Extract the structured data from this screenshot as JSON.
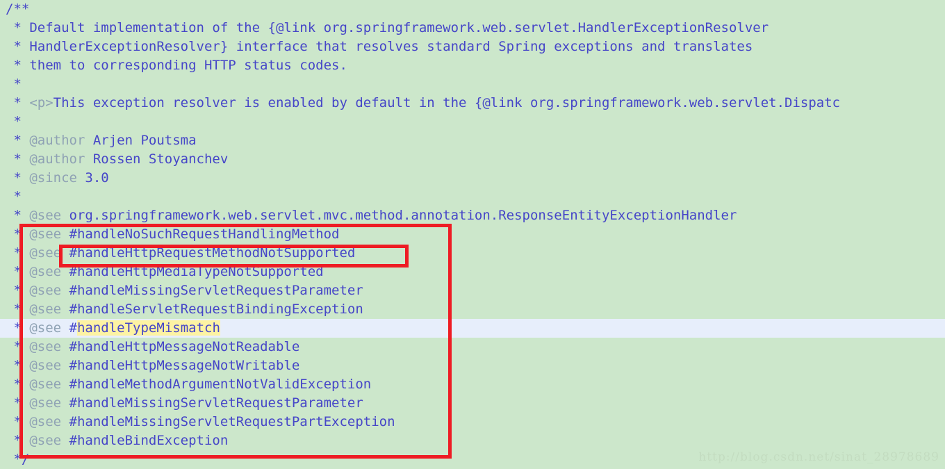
{
  "editor": {
    "background_color": "#cce7cb",
    "text_color": "#4646c8",
    "tag_color": "#8fa2b4",
    "current_line_color": "#e7eefb",
    "search_highlight_color": "#fdf3a3",
    "annotation_color": "#ee1c24",
    "font_size_px": 19,
    "line_height_px": 27,
    "language": "java",
    "content_kind": "javadoc-comment"
  },
  "watermark": {
    "text": "http://blog.csdn.net/sinat_28978689"
  },
  "annotations": [
    {
      "name": "outer-red-rectangle",
      "shape": "rectangle",
      "color": "#ee1c24",
      "covers": "the block of @see handler references from #handleNoSuchRequestHandlingMethod through #handleBindException"
    },
    {
      "name": "inner-red-rectangle",
      "shape": "rectangle",
      "color": "#ee1c24",
      "covers": "#handleHttpRequestMethodNotSupported"
    }
  ],
  "lines": [
    {
      "index": 0,
      "current": false,
      "segments": [
        {
          "kind": "delim",
          "text": "/**"
        }
      ]
    },
    {
      "index": 1,
      "current": false,
      "segments": [
        {
          "kind": "delim",
          "text": " * "
        },
        {
          "kind": "text",
          "text": "Default implementation of the "
        },
        {
          "kind": "link",
          "text": "{@link org.springframework.web.servlet.HandlerExceptionResolver"
        }
      ]
    },
    {
      "index": 2,
      "current": false,
      "segments": [
        {
          "kind": "delim",
          "text": " * "
        },
        {
          "kind": "link",
          "text": "HandlerExceptionResolver}"
        },
        {
          "kind": "text",
          "text": " interface that resolves standard Spring exceptions and translates"
        }
      ]
    },
    {
      "index": 3,
      "current": false,
      "segments": [
        {
          "kind": "delim",
          "text": " * "
        },
        {
          "kind": "text",
          "text": "them to corresponding HTTP status codes."
        }
      ]
    },
    {
      "index": 4,
      "current": false,
      "segments": [
        {
          "kind": "delim",
          "text": " *"
        }
      ]
    },
    {
      "index": 5,
      "current": false,
      "segments": [
        {
          "kind": "delim",
          "text": " * "
        },
        {
          "kind": "html",
          "text": "<p>"
        },
        {
          "kind": "text",
          "text": "This exception resolver is enabled by default in the "
        },
        {
          "kind": "link",
          "text": "{@link org.springframework.web.servlet.Dispatc"
        }
      ]
    },
    {
      "index": 6,
      "current": false,
      "segments": [
        {
          "kind": "delim",
          "text": " *"
        }
      ]
    },
    {
      "index": 7,
      "current": false,
      "segments": [
        {
          "kind": "delim",
          "text": " * "
        },
        {
          "kind": "tag",
          "text": "@author"
        },
        {
          "kind": "text",
          "text": " Arjen Poutsma"
        }
      ]
    },
    {
      "index": 8,
      "current": false,
      "segments": [
        {
          "kind": "delim",
          "text": " * "
        },
        {
          "kind": "tag",
          "text": "@author"
        },
        {
          "kind": "text",
          "text": " Rossen Stoyanchev"
        }
      ]
    },
    {
      "index": 9,
      "current": false,
      "segments": [
        {
          "kind": "delim",
          "text": " * "
        },
        {
          "kind": "tag",
          "text": "@since"
        },
        {
          "kind": "text",
          "text": " 3.0"
        }
      ]
    },
    {
      "index": 10,
      "current": false,
      "segments": [
        {
          "kind": "delim",
          "text": " *"
        }
      ]
    },
    {
      "index": 11,
      "current": false,
      "segments": [
        {
          "kind": "delim",
          "text": " * "
        },
        {
          "kind": "tag",
          "text": "@see"
        },
        {
          "kind": "link",
          "text": " org.springframework.web.servlet.mvc.method.annotation.ResponseEntityExceptionHandler"
        }
      ]
    },
    {
      "index": 12,
      "current": false,
      "segments": [
        {
          "kind": "delim",
          "text": " * "
        },
        {
          "kind": "tag",
          "text": "@see"
        },
        {
          "kind": "link",
          "text": " #handleNoSuchRequestHandlingMethod"
        }
      ]
    },
    {
      "index": 13,
      "current": false,
      "segments": [
        {
          "kind": "delim",
          "text": " * "
        },
        {
          "kind": "tag",
          "text": "@see"
        },
        {
          "kind": "link",
          "text": " #handleHttpRequestMethodNotSupported"
        }
      ]
    },
    {
      "index": 14,
      "current": false,
      "segments": [
        {
          "kind": "delim",
          "text": " * "
        },
        {
          "kind": "tag",
          "text": "@see"
        },
        {
          "kind": "link",
          "text": " #handleHttpMediaTypeNotSupported"
        }
      ]
    },
    {
      "index": 15,
      "current": false,
      "segments": [
        {
          "kind": "delim",
          "text": " * "
        },
        {
          "kind": "tag",
          "text": "@see"
        },
        {
          "kind": "link",
          "text": " #handleMissingServletRequestParameter"
        }
      ]
    },
    {
      "index": 16,
      "current": false,
      "segments": [
        {
          "kind": "delim",
          "text": " * "
        },
        {
          "kind": "tag",
          "text": "@see"
        },
        {
          "kind": "link",
          "text": " #handleServletRequestBindingException"
        }
      ]
    },
    {
      "index": 17,
      "current": true,
      "segments": [
        {
          "kind": "delim",
          "text": " * "
        },
        {
          "kind": "tag",
          "text": "@see"
        },
        {
          "kind": "link",
          "text": " #"
        },
        {
          "kind": "highlight",
          "text": "handleTypeMismatch"
        }
      ]
    },
    {
      "index": 18,
      "current": false,
      "segments": [
        {
          "kind": "delim",
          "text": " * "
        },
        {
          "kind": "tag",
          "text": "@see"
        },
        {
          "kind": "link",
          "text": " #handleHttpMessageNotReadable"
        }
      ]
    },
    {
      "index": 19,
      "current": false,
      "segments": [
        {
          "kind": "delim",
          "text": " * "
        },
        {
          "kind": "tag",
          "text": "@see"
        },
        {
          "kind": "link",
          "text": " #handleHttpMessageNotWritable"
        }
      ]
    },
    {
      "index": 20,
      "current": false,
      "segments": [
        {
          "kind": "delim",
          "text": " * "
        },
        {
          "kind": "tag",
          "text": "@see"
        },
        {
          "kind": "link",
          "text": " #handleMethodArgumentNotValidException"
        }
      ]
    },
    {
      "index": 21,
      "current": false,
      "segments": [
        {
          "kind": "delim",
          "text": " * "
        },
        {
          "kind": "tag",
          "text": "@see"
        },
        {
          "kind": "link",
          "text": " #handleMissingServletRequestParameter"
        }
      ]
    },
    {
      "index": 22,
      "current": false,
      "segments": [
        {
          "kind": "delim",
          "text": " * "
        },
        {
          "kind": "tag",
          "text": "@see"
        },
        {
          "kind": "link",
          "text": " #handleMissingServletRequestPartException"
        }
      ]
    },
    {
      "index": 23,
      "current": false,
      "segments": [
        {
          "kind": "delim",
          "text": " * "
        },
        {
          "kind": "tag",
          "text": "@see"
        },
        {
          "kind": "link",
          "text": " #handleBindException"
        }
      ]
    },
    {
      "index": 24,
      "current": false,
      "segments": [
        {
          "kind": "delim",
          "text": " */"
        }
      ]
    }
  ]
}
